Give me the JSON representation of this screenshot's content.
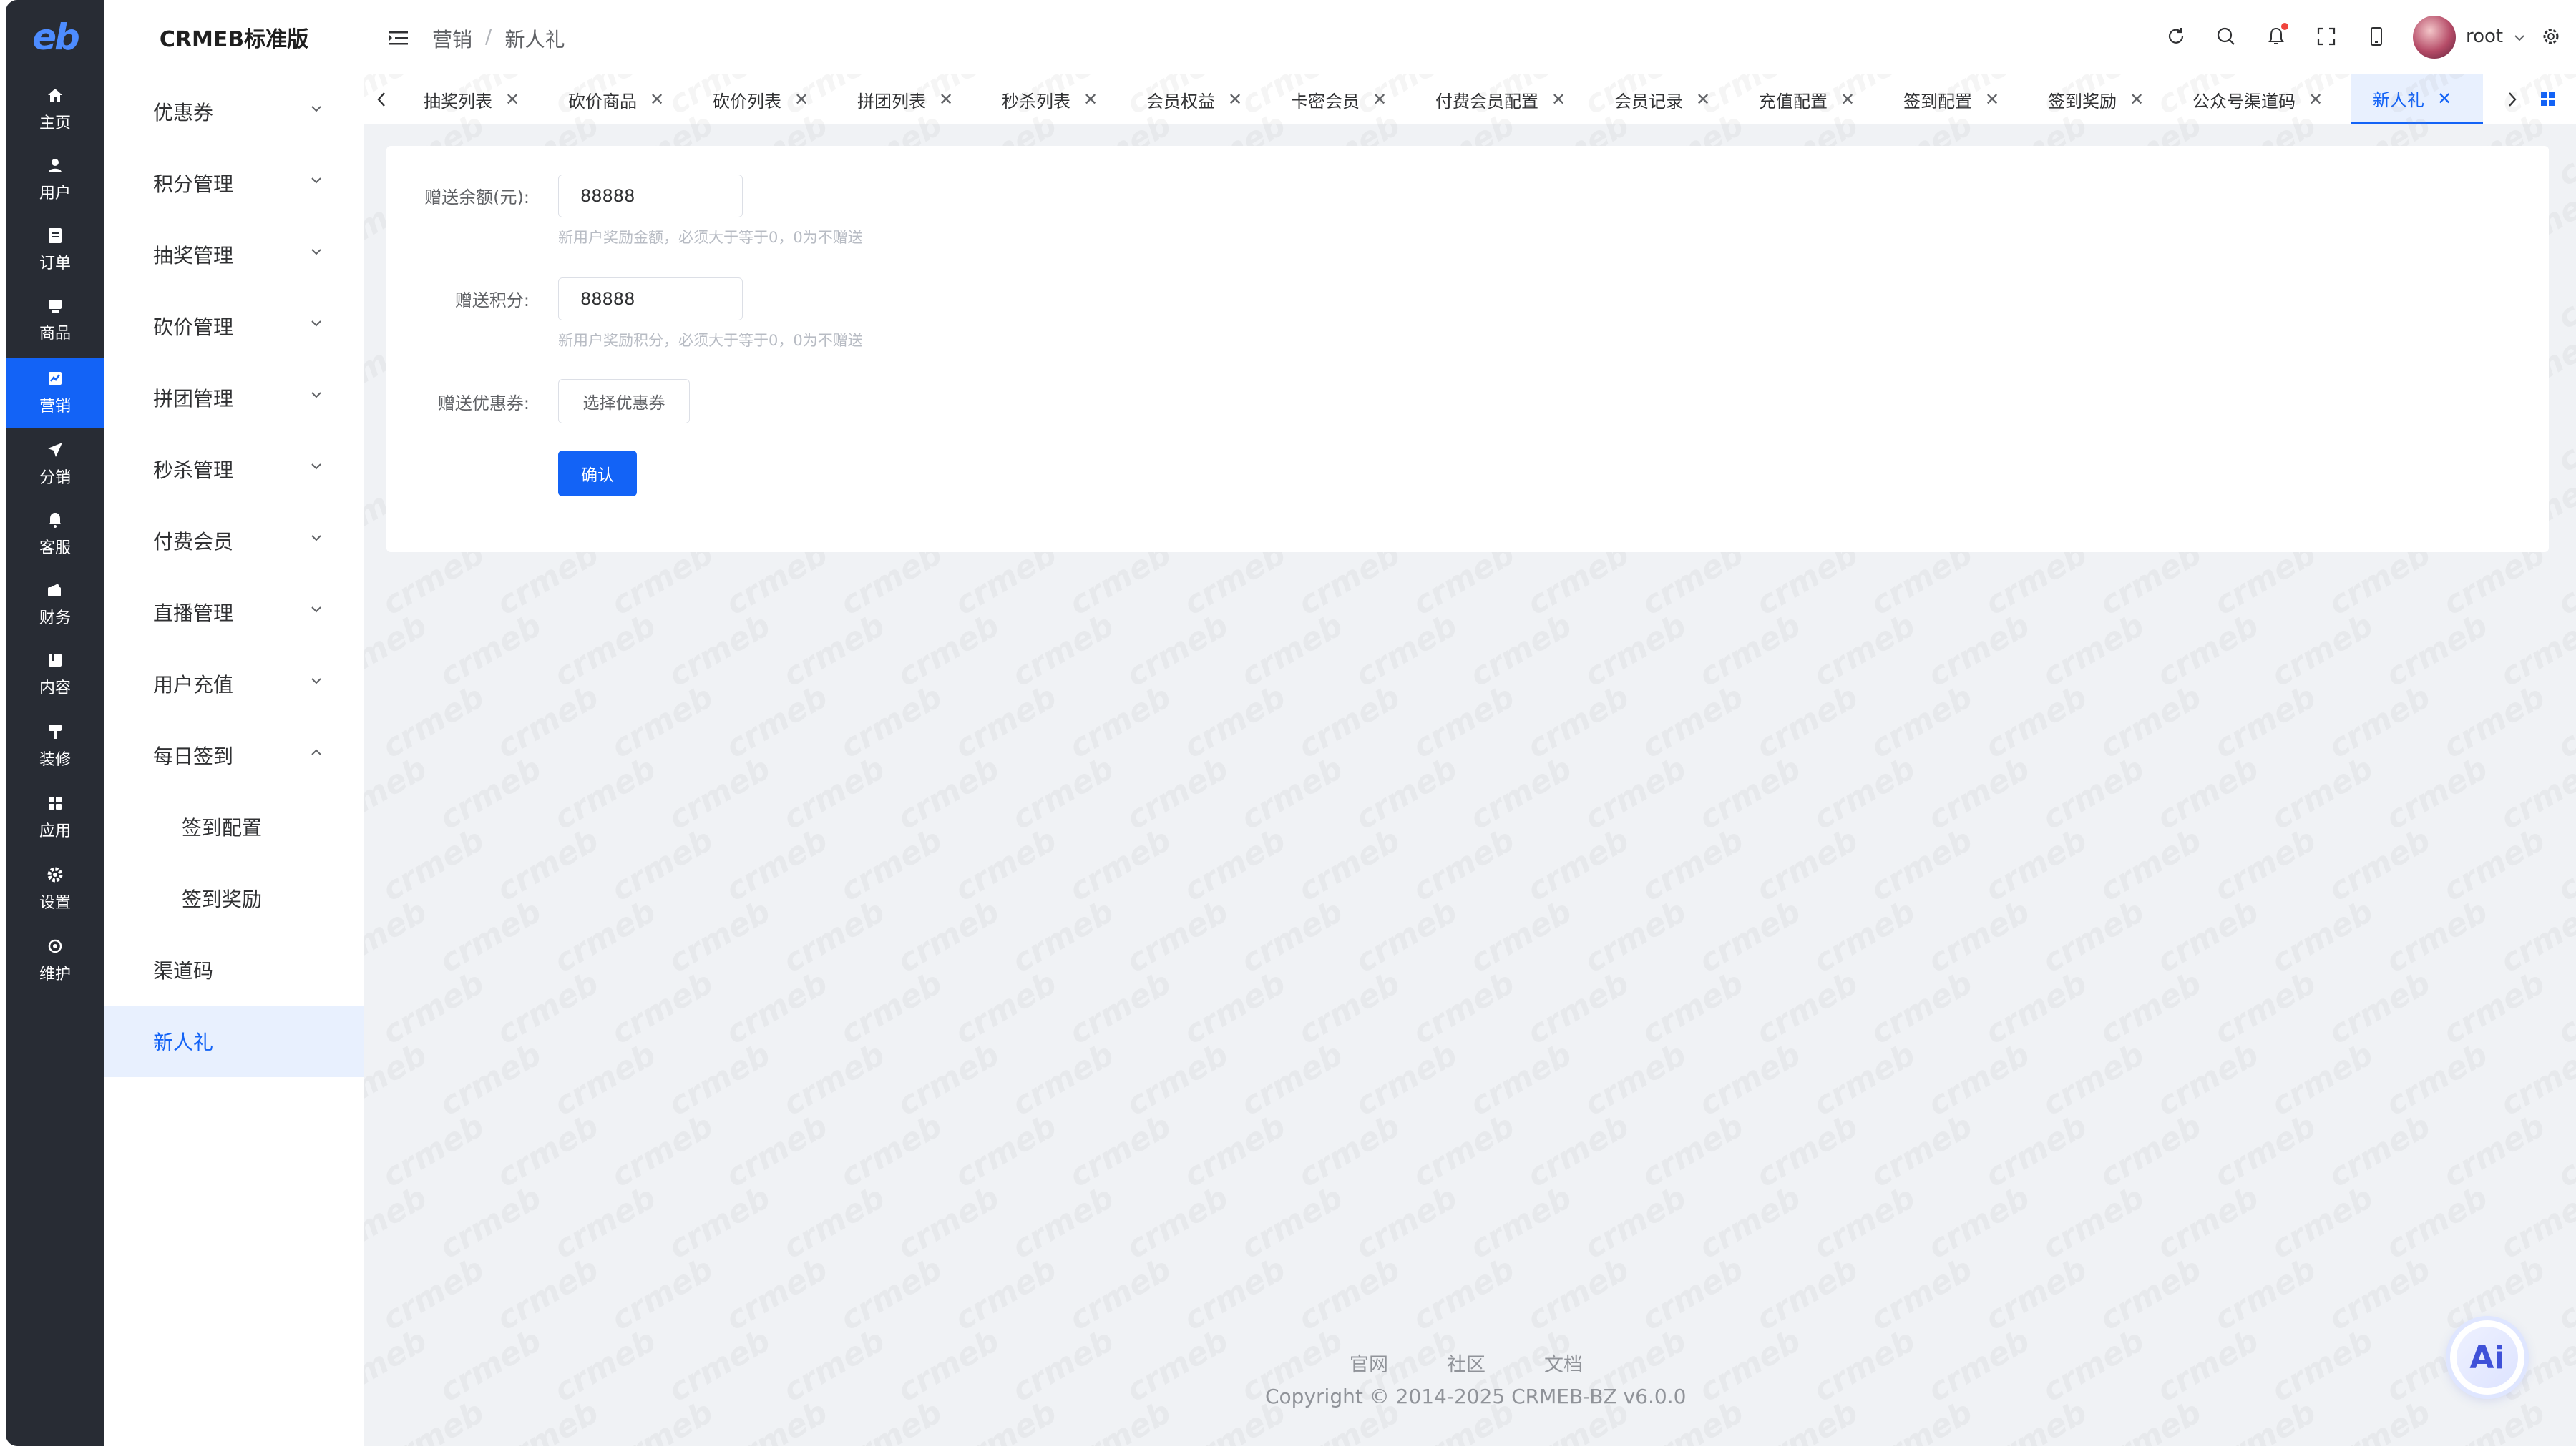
{
  "logo": "eb",
  "rail": {
    "items": [
      {
        "label": "主页",
        "icon": "home-icon"
      },
      {
        "label": "用户",
        "icon": "user-icon"
      },
      {
        "label": "订单",
        "icon": "order-icon"
      },
      {
        "label": "商品",
        "icon": "goods-icon"
      },
      {
        "label": "营销",
        "icon": "marketing-icon",
        "active": true
      },
      {
        "label": "分销",
        "icon": "distribution-icon"
      },
      {
        "label": "客服",
        "icon": "service-icon"
      },
      {
        "label": "财务",
        "icon": "finance-icon"
      },
      {
        "label": "内容",
        "icon": "content-icon"
      },
      {
        "label": "装修",
        "icon": "decoration-icon"
      },
      {
        "label": "应用",
        "icon": "apps-icon"
      },
      {
        "label": "设置",
        "icon": "settings-icon"
      },
      {
        "label": "维护",
        "icon": "maintenance-icon"
      }
    ]
  },
  "subnav": {
    "brand": "CRMEB标准版",
    "items": [
      {
        "label": "优惠券",
        "chevron": "down"
      },
      {
        "label": "积分管理",
        "chevron": "down"
      },
      {
        "label": "抽奖管理",
        "chevron": "down"
      },
      {
        "label": "砍价管理",
        "chevron": "down"
      },
      {
        "label": "拼团管理",
        "chevron": "down"
      },
      {
        "label": "秒杀管理",
        "chevron": "down"
      },
      {
        "label": "付费会员",
        "chevron": "down"
      },
      {
        "label": "直播管理",
        "chevron": "down"
      },
      {
        "label": "用户充值",
        "chevron": "down"
      },
      {
        "label": "每日签到",
        "chevron": "up"
      },
      {
        "label": "签到配置",
        "child": true
      },
      {
        "label": "签到奖励",
        "child": true
      },
      {
        "label": "渠道码"
      },
      {
        "label": "新人礼",
        "active": true
      }
    ]
  },
  "header": {
    "breadcrumb": [
      "营销",
      "新人礼"
    ],
    "separator": "/",
    "username": "root"
  },
  "tabs": [
    "抽奖列表",
    "砍价商品",
    "砍价列表",
    "拼团列表",
    "秒杀列表",
    "会员权益",
    "卡密会员",
    "付费会员配置",
    "会员记录",
    "充值配置",
    "签到配置",
    "签到奖励",
    "公众号渠道码",
    "新人礼"
  ],
  "active_tab": "新人礼",
  "form": {
    "balance_label": "赠送余额(元):",
    "balance_value": "88888",
    "balance_help": "新用户奖励金额，必须大于等于0，0为不赠送",
    "points_label": "赠送积分:",
    "points_value": "88888",
    "points_help": "新用户奖励积分，必须大于等于0，0为不赠送",
    "coupon_label": "赠送优惠券:",
    "coupon_button": "选择优惠券",
    "confirm_button": "确认"
  },
  "footer": {
    "links": [
      "官网",
      "社区",
      "文档"
    ],
    "copyright": "Copyright © 2014-2025 CRMEB-BZ v6.0.0"
  },
  "ai_button": "Ai",
  "watermark_text": "crmeb",
  "colors": {
    "primary": "#1363f6",
    "rail_bg": "#282c34",
    "main_bg": "#f0f2f5",
    "active_bg": "#e8f0fe"
  }
}
